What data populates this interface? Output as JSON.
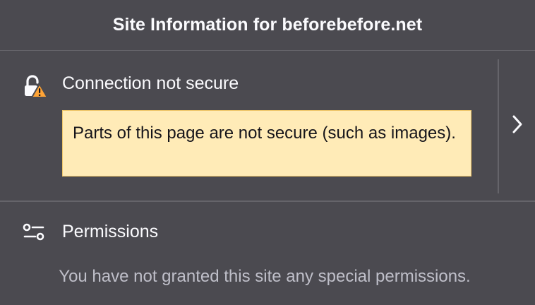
{
  "header": {
    "title": "Site Information for beforebefore.net"
  },
  "security": {
    "icon": "insecure-lock-warning-icon",
    "title": "Connection not secure",
    "warning": "Parts of this page are not secure (such as images).",
    "more_icon": "chevron-right-icon"
  },
  "permissions": {
    "icon": "permissions-sliders-icon",
    "title": "Permissions",
    "description": "You have not granted this site any special permissions."
  },
  "colors": {
    "background": "#4b4a50",
    "text": "#fbfbfe",
    "muted_text": "#bfbfc9",
    "warning_bg": "#ffebb7",
    "warning_border": "#eec66b",
    "warning_icon": "#ffa436",
    "divider": "#65646a"
  }
}
